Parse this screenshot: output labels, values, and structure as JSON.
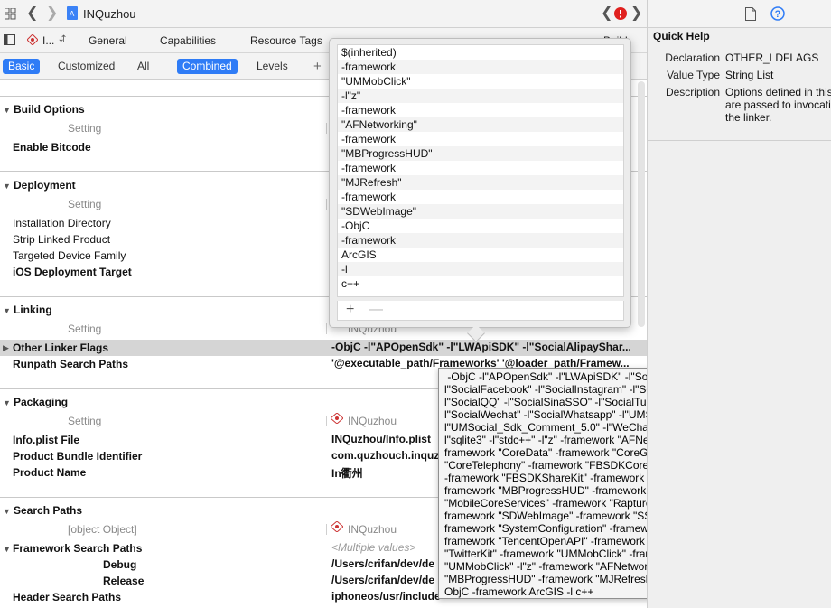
{
  "toolbar": {
    "project_name": "INQuzhou",
    "target_short": "I...",
    "icons": [
      "grid-icon",
      "back-icon",
      "forward-icon",
      "project-file-icon",
      "issue-icon",
      "document-icon",
      "help-icon"
    ]
  },
  "tabs": [
    "General",
    "Capabilities",
    "Resource Tags",
    "Build Rule"
  ],
  "filter": {
    "basic": "Basic",
    "customized": "Customized",
    "all": "All",
    "combined": "Combined",
    "levels": "Levels",
    "add": "+"
  },
  "sections": {
    "build_options": {
      "title": "Build Options",
      "header": "Setting",
      "rows": [
        {
          "label": "Enable Bitcode",
          "value": ""
        }
      ]
    },
    "deployment": {
      "title": "Deployment",
      "header": "Setting",
      "rows": [
        {
          "label": "Installation Directory",
          "value": ""
        },
        {
          "label": "Strip Linked Product",
          "value": ""
        },
        {
          "label": "Targeted Device Family",
          "value": ""
        },
        {
          "label": "iOS Deployment Target",
          "value": ""
        }
      ]
    },
    "linking": {
      "title": "Linking",
      "header": "Setting",
      "target": "INQuzhou",
      "other_linker_flags": {
        "label": "Other Linker Flags",
        "value": "-ObjC -l\"APOpenSdk\" -l\"LWApiSDK\" -l\"SocialAlipayShar..."
      },
      "runpath": {
        "label": "Runpath Search Paths",
        "value": "'@executable_path/Frameworks' '@loader_path/Framew..."
      }
    },
    "packaging": {
      "title": "Packaging",
      "header": "Setting",
      "target": "INQuzhou",
      "info_plist": {
        "label": "Info.plist File",
        "value": "INQuzhou/Info.plist"
      },
      "bundle_id": {
        "label": "Product Bundle Identifier",
        "value": "com.quzhouch.inquzh"
      },
      "product_name": {
        "label": "Product Name",
        "value": "In衢州"
      }
    },
    "search_paths": {
      "title": "Search Paths",
      "header": {
        "label": "Header Search Paths",
        "value": "iphoneos/usr/include"
      },
      "target": "INQuzhou",
      "framework": {
        "label": "Framework Search Paths",
        "value": "<Multiple values>"
      },
      "debug": {
        "label": "Debug",
        "value": "/Users/crifan/dev/de"
      },
      "release": {
        "label": "Release",
        "value": "/Users/crifan/dev/de"
      }
    }
  },
  "popover": {
    "items": [
      "$(inherited)",
      "-framework",
      "\"UMMobClick\"",
      "-l\"z\"",
      "-framework",
      "\"AFNetworking\"",
      "-framework",
      "\"MBProgressHUD\"",
      "-framework",
      "\"MJRefresh\"",
      "-framework",
      "\"SDWebImage\"",
      "-ObjC",
      "-framework",
      "ArcGIS",
      "-l",
      "c++"
    ],
    "add": "+",
    "remove": "—"
  },
  "tooltip": {
    "text": " -ObjC -l\"APOpenSdk\" -l\"LWApiSDK\" -l\"SocialAlipayShare\" -l\"SocialFacebook\" -l\"SocialInstagram\" -l\"SocialLaiWang\" -l\"SocialLine\" -l\"SocialQQ\" -l\"SocialSinaSSO\" -l\"SocialTumblr\" -l\"SocialTwitter\" -l\"SocialWechat\" -l\"SocialWhatsapp\" -l\"UMSocial_Sdk_5.0\" -l\"UMSocial_Sdk_Comment_5.0\" -l\"WeChatSDK\" -l\"WeiboSDK\" -l\"iconv\" -l\"sqlite3\" -l\"stdc++\" -l\"z\" -framework \"AFNetworking\" -framework \"Accounts\" -framework \"CoreData\" -framework \"CoreGraphics\" -framework \"CoreTelephony\" -framework \"FBSDKCoreKit\" -framework \"FBSDKLoginKit\" -framework \"FBSDKShareKit\" -framework \"Fabric\" -framework \"ImageIO\" -framework \"MBProgressHUD\" -framework \"MJRefresh\" -framework \"MobileCoreServices\" -framework \"RaptureXML\" -framework \"Realm\" -framework \"SDWebImage\" -framework \"SSZipArchive\" -framework \"Social\" -framework \"SystemConfiguration\" -framework \"TCBlobDownload\" -framework \"TencentOpenAPI\" -framework \"TwitterCore\" -framework \"TwitterKit\" -framework \"UMMobClick\" -framework \"YYModel\" -framework \"UMMobClick\" -l\"z\" -framework \"AFNetworking\" -framework \"MBProgressHUD\" -framework \"MJRefresh\" -framework \"SDWebImage\" -ObjC -framework ArcGIS -l c++"
  },
  "quick_help": {
    "title": "Quick Help",
    "declaration_key": "Declaration",
    "declaration_val": "OTHER_LDFLAGS",
    "type_key": "Value Type",
    "type_val": "String List",
    "desc_key": "Description",
    "desc_lines": [
      "Options defined in this",
      "are passed to invocatio",
      "the linker."
    ]
  }
}
